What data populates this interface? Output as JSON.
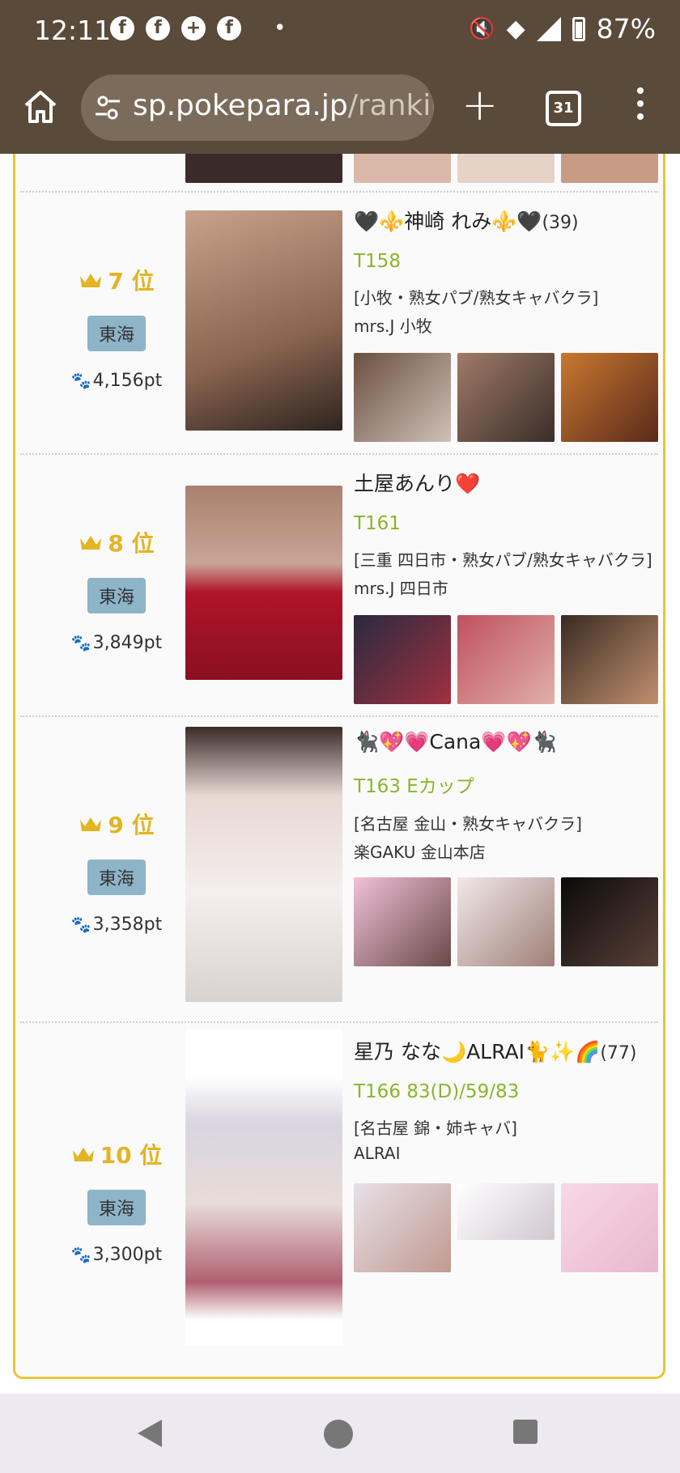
{
  "status_bar": {
    "time": "12:11",
    "battery": "87%",
    "notification_icons": [
      "facebook-icon",
      "facebook-icon",
      "add-friend-icon",
      "facebook-icon"
    ],
    "system_icons": [
      "mute-icon",
      "wifi-icon",
      "signal-icon",
      "battery-icon"
    ]
  },
  "browser": {
    "url_host": "sp.pokepara.jp",
    "url_path": "/rankir",
    "tab_count": "31"
  },
  "colors": {
    "chrome": "#5a4a3a",
    "rank_gold": "#e4b422",
    "spec_green": "#8ab52a",
    "area_badge": "#8eb4c8",
    "panel_border": "#e8c637"
  },
  "entries": [
    {
      "rank_num": "7",
      "rank_suffix": "位",
      "area": "東海",
      "points": "4,156pt",
      "name": "🖤⚜️神崎 れみ⚜️🖤",
      "age": "(39)",
      "spec": "T158",
      "shop_area": "[小牧・熟女パブ/熟女キャバクラ]",
      "shop_name": "mrs.J 小牧"
    },
    {
      "rank_num": "8",
      "rank_suffix": "位",
      "area": "東海",
      "points": "3,849pt",
      "name": "土屋あんり❤️",
      "age": "",
      "spec": "T161",
      "shop_area": "[三重 四日市・熟女パブ/熟女キャバクラ]",
      "shop_name": "mrs.J 四日市"
    },
    {
      "rank_num": "9",
      "rank_suffix": "位",
      "area": "東海",
      "points": "3,358pt",
      "name": "🐈‍⬛💖💗Cana💗💖🐈‍⬛",
      "age": "",
      "spec": "T163 Eカップ",
      "shop_area": "[名古屋 金山・熟女キャバクラ]",
      "shop_name": "楽GAKU 金山本店"
    },
    {
      "rank_num": "10",
      "rank_suffix": "位",
      "area": "東海",
      "points": "3,300pt",
      "name": "星乃 なな🌙ALRAI🐈✨🌈",
      "age": "(77)",
      "spec": "T166 83(D)/59/83",
      "shop_area": "[名古屋 錦・姉キャバ]",
      "shop_name": "ALRAI"
    }
  ]
}
